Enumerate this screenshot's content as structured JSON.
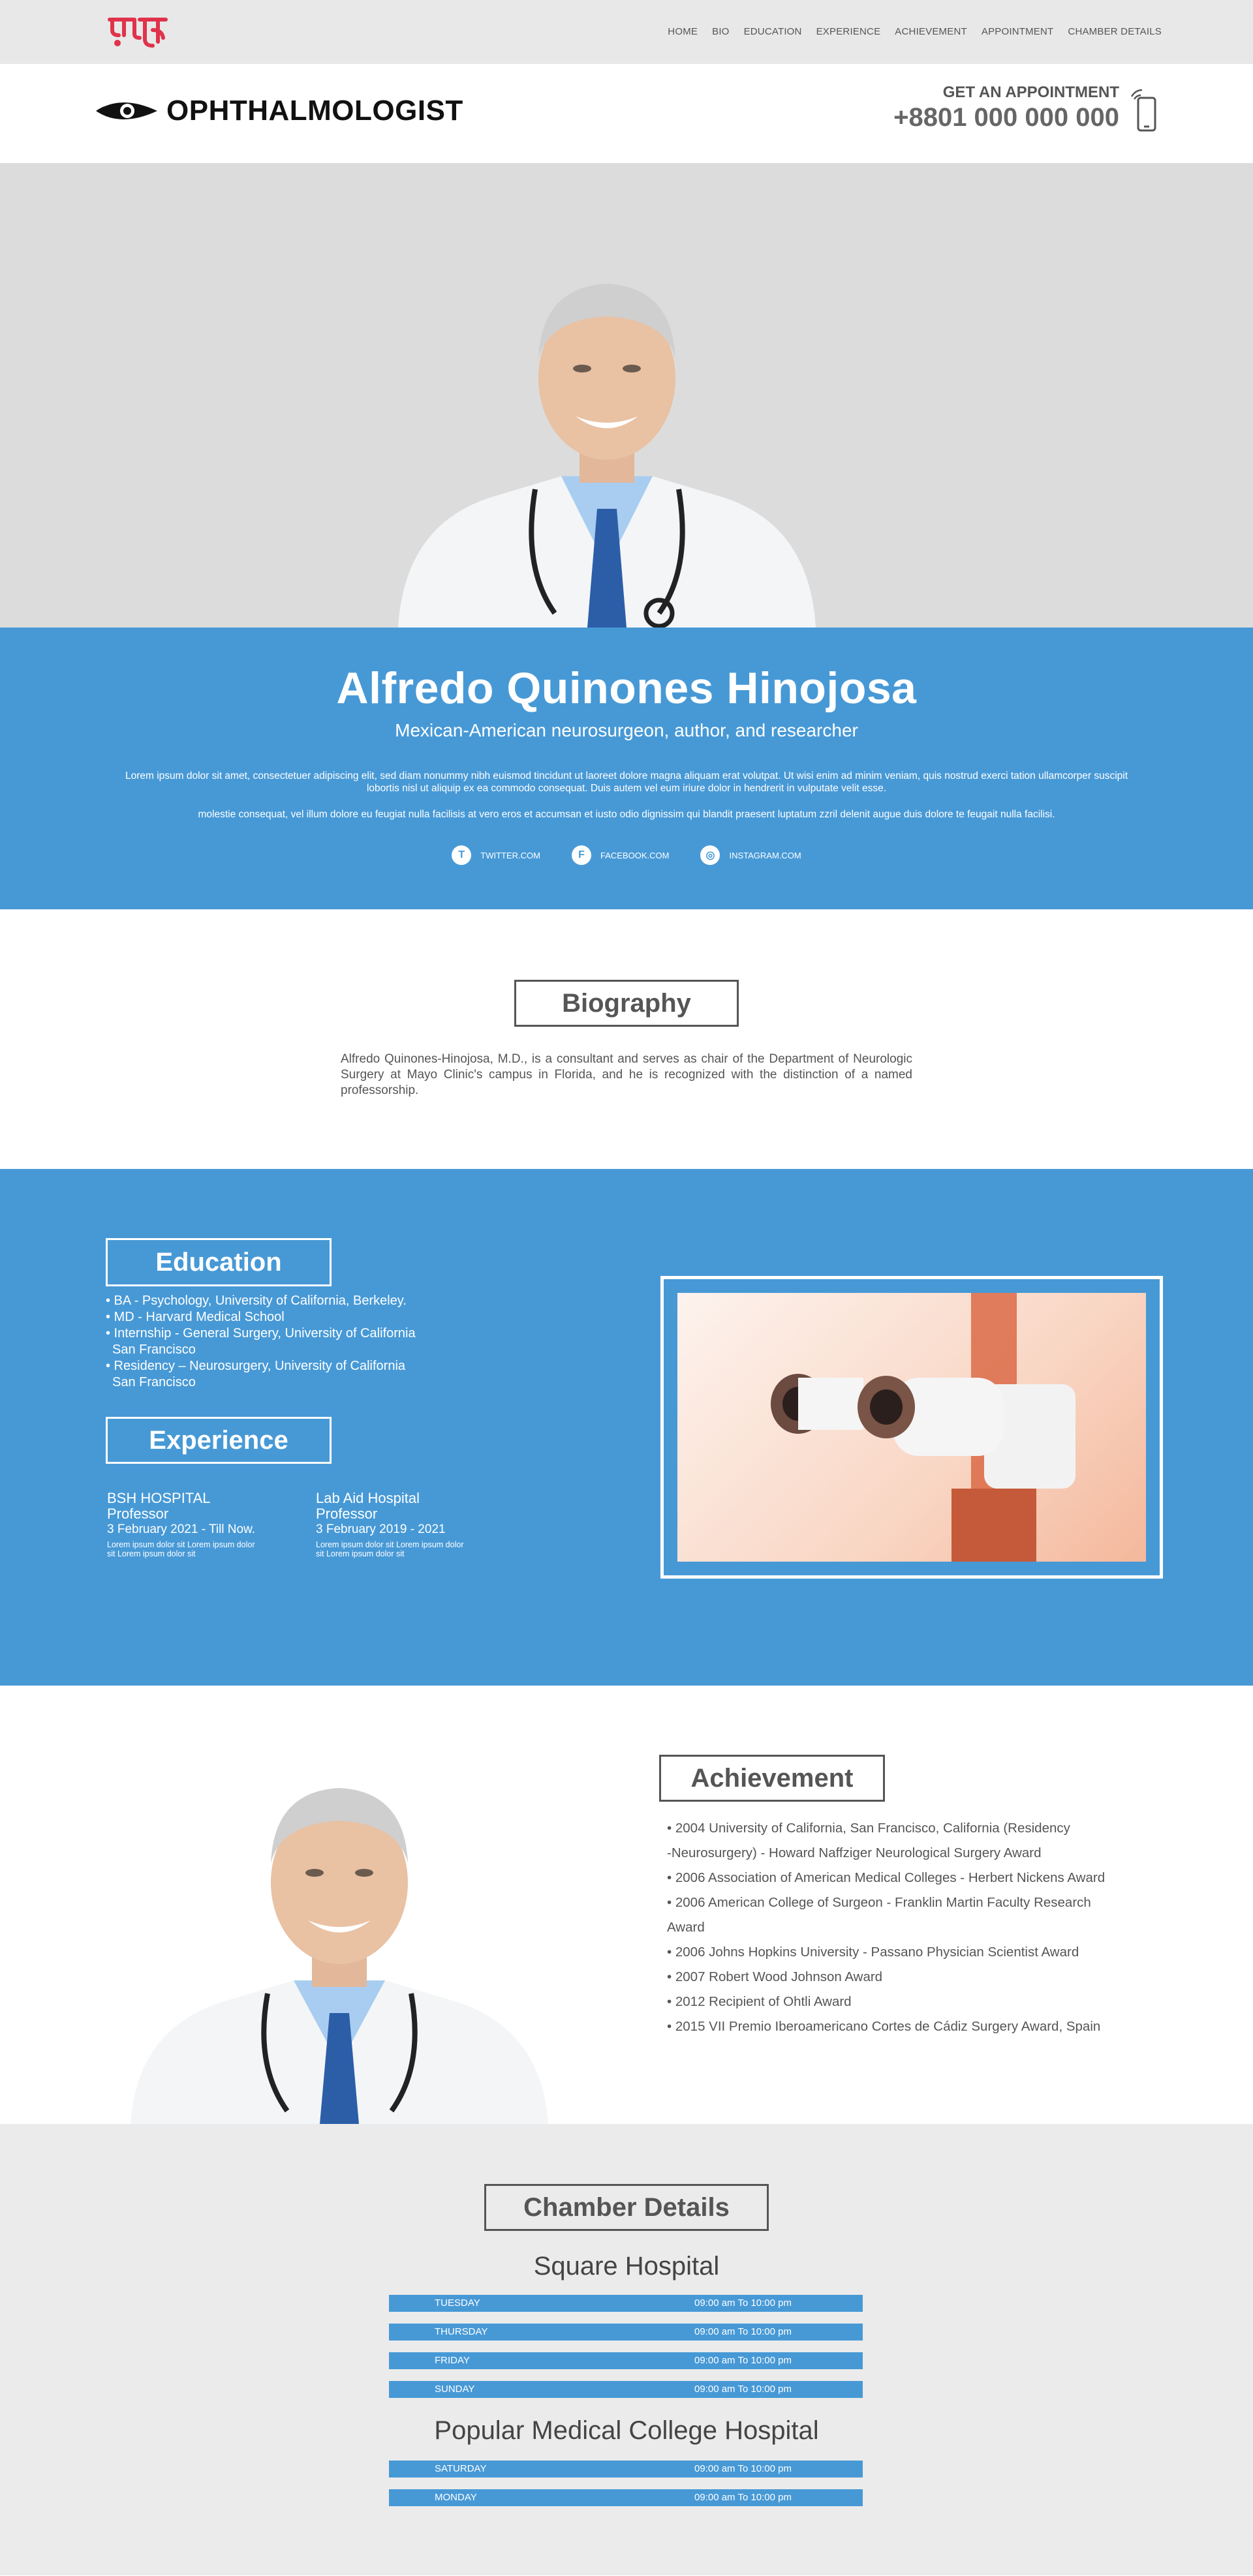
{
  "nav": {
    "items": [
      "HOME",
      "BIO",
      "EDUCATION",
      "EXPERIENCE",
      "ACHIEVEMENT",
      "APPOINTMENT",
      "CHAMBER DETAILS"
    ]
  },
  "header": {
    "brand": "OPHTHALMOLOGIST",
    "appointment_label": "GET AN APPOINTMENT",
    "phone": "+8801 000 000 000"
  },
  "hero": {
    "name": "Alfredo Quinones Hinojosa",
    "subtitle": "Mexican-American neurosurgeon, author, and researcher",
    "lorem1": "Lorem ipsum dolor sit amet, consectetuer adipiscing elit, sed diam nonummy nibh euismod tincidunt ut laoreet dolore magna aliquam erat volutpat. Ut wisi enim ad minim veniam, quis nostrud exerci tation ullamcorper suscipit lobortis nisl ut aliquip ex ea commodo consequat. Duis autem vel eum iriure dolor in hendrerit in vulputate velit esse.",
    "lorem2": "molestie consequat, vel illum dolore eu feugiat nulla facilisis at vero eros et accumsan et iusto odio dignissim qui blandit praesent luptatum zzril delenit augue duis dolore te feugait nulla facilisi.",
    "socials": [
      {
        "label": "TWITTER.COM",
        "icon": "twitter-icon"
      },
      {
        "label": "FACEBOOK.COM",
        "icon": "facebook-icon"
      },
      {
        "label": "INSTAGRAM.COM",
        "icon": "instagram-icon"
      }
    ]
  },
  "bio": {
    "title": "Biography",
    "text": "Alfredo Quinones-Hinojosa, M.D., is a consultant and serves as chair of the Department of Neurologic Surgery at Mayo Clinic's campus in Florida, and he is recognized with the distinction of a named professorship."
  },
  "education": {
    "title": "Education",
    "items": [
      "• BA - Psychology, University of California, Berkeley.",
      "• MD - Harvard Medical School",
      "• Internship - General Surgery, University of California",
      "  San Francisco",
      "• Residency – Neurosurgery, University of California",
      "  San Francisco"
    ]
  },
  "experience": {
    "title": "Experience",
    "items": [
      {
        "org": "BSH HOSPITAL",
        "role": "Professor",
        "dates": "3 February  2021 - Till Now.",
        "note": "Lorem ipsum dolor sit Lorem ipsum dolor sit  Lorem ipsum dolor sit"
      },
      {
        "org": "Lab Aid Hospital",
        "role": "Professor",
        "dates": "3 February  2019 - 2021",
        "note": "Lorem ipsum dolor sit Lorem ipsum dolor sit  Lorem ipsum dolor sit"
      }
    ]
  },
  "achievement": {
    "title": "Achievement",
    "items": [
      "• 2004 University of California, San Francisco, California (Residency",
      "  -Neurosurgery) - Howard Naffziger Neurological Surgery Award",
      "• 2006 Association of American Medical Colleges - Herbert Nickens Award",
      "• 2006 American College of Surgeon - Franklin Martin Faculty Research",
      "  Award",
      "• 2006 Johns Hopkins University - Passano Physician Scientist Award",
      "• 2007 Robert Wood Johnson Award",
      "• 2012 Recipient of Ohtli Award",
      "• 2015 VII Premio Iberoamericano Cortes de Cádiz Surgery Award, Spain"
    ]
  },
  "chamber": {
    "title": "Chamber Details",
    "hospitals": [
      {
        "name": "Square Hospital",
        "schedule": [
          {
            "day": "TUESDAY",
            "time": "09:00 am To 10:00 pm"
          },
          {
            "day": "THURSDAY",
            "time": "09:00 am To 10:00 pm"
          },
          {
            "day": "FRIDAY",
            "time": "09:00 am To 10:00 pm"
          },
          {
            "day": "SUNDAY",
            "time": "09:00 am To 10:00 pm"
          }
        ]
      },
      {
        "name": "Popular Medical College Hospital",
        "schedule": [
          {
            "day": "SATURDAY",
            "time": "09:00 am To 10:00 pm"
          },
          {
            "day": "MONDAY",
            "time": "09:00 am To 10:00 pm"
          }
        ]
      }
    ]
  },
  "colors": {
    "accent": "#4799d6",
    "logo_red": "#e0334b",
    "gray_bg": "#dcdcdc"
  }
}
